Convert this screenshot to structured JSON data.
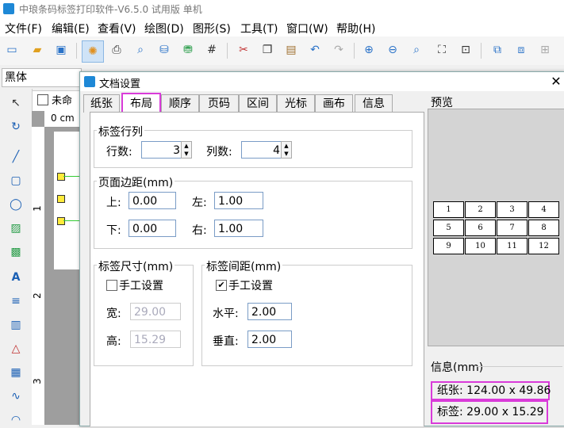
{
  "app": {
    "title": "中琅条码标签打印软件-V6.5.0 试用版 单机"
  },
  "menu": [
    "文件(F)",
    "编辑(E)",
    "查看(V)",
    "绘图(D)",
    "图形(S)",
    "工具(T)",
    "窗口(W)",
    "帮助(H)"
  ],
  "font": {
    "name": "黑体"
  },
  "document": {
    "tab": "未命名",
    "ruler_top": "0 cm",
    "ruler_marks": [
      "1",
      "2",
      "3"
    ]
  },
  "dialog": {
    "title": "文档设置",
    "close": "✕",
    "tabs": [
      "纸张",
      "布局",
      "顺序",
      "页码",
      "区间",
      "光标",
      "画布",
      "信息"
    ],
    "selected_tab": "布局",
    "label_rows": {
      "title": "标签行列",
      "rows_label": "行数:",
      "rows_value": "3",
      "cols_label": "列数:",
      "cols_value": "4"
    },
    "margins": {
      "title": "页面边距(mm)",
      "top_label": "上:",
      "top": "0.00",
      "left_label": "左:",
      "left": "1.00",
      "bottom_label": "下:",
      "bottom": "0.00",
      "right_label": "右:",
      "right": "1.00"
    },
    "label_size": {
      "title": "标签尺寸(mm)",
      "manual_label": "手工设置",
      "manual_checked": false,
      "width_label": "宽:",
      "width": "29.00",
      "height_label": "高:",
      "height": "15.29"
    },
    "label_gap": {
      "title": "标签间距(mm)",
      "manual_label": "手工设置",
      "manual_checked": true,
      "h_label": "水平:",
      "horizontal": "2.00",
      "v_label": "垂直:",
      "vertical": "2.00"
    },
    "preview": {
      "title": "预览",
      "cells": [
        "1",
        "2",
        "3",
        "4",
        "5",
        "6",
        "7",
        "8",
        "9",
        "10",
        "11",
        "12"
      ]
    },
    "info": {
      "title": "信息(mm)",
      "paper": "纸张: 124.00 x 49.86",
      "label": "标签: 29.00 x 15.29"
    }
  },
  "colors": {
    "highlight": "#d93bd9",
    "accent": "#1e88d6"
  }
}
